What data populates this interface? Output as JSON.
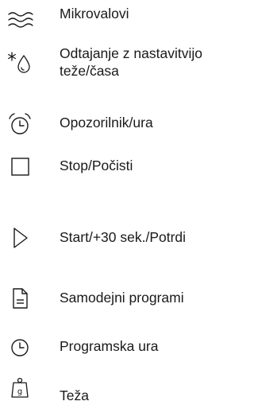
{
  "legend": {
    "items": [
      {
        "icon": "microwave-waves-icon",
        "lines": [
          "Mikrovalovi"
        ]
      },
      {
        "icon": "defrost-icon",
        "lines": [
          "Odtajanje z nastavitvijo",
          "teže/časa"
        ]
      },
      {
        "icon": "alarm-clock-icon",
        "lines": [
          "Opozorilnik/ura"
        ]
      },
      {
        "icon": "stop-square-icon",
        "lines": [
          "Stop/Počisti"
        ]
      },
      {
        "icon": "play-triangle-icon",
        "lines": [
          "Start/+30 sek./Potrdi"
        ]
      },
      {
        "icon": "document-icon",
        "lines": [
          "Samodejni programi"
        ]
      },
      {
        "icon": "clock-icon",
        "lines": [
          "Programska ura"
        ]
      },
      {
        "icon": "weight-icon",
        "lines": [
          "Teža"
        ]
      }
    ]
  }
}
